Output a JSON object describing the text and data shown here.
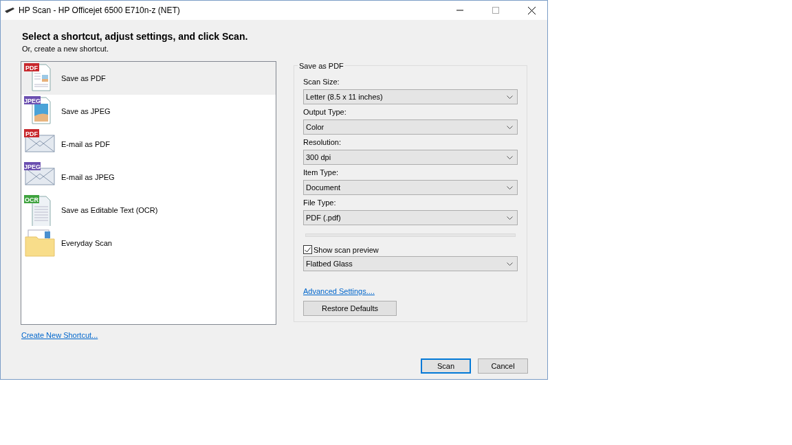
{
  "window": {
    "title": "HP Scan - HP Officejet 6500 E710n-z (NET)"
  },
  "heading": "Select a shortcut, adjust settings, and click Scan.",
  "subheading": "Or, create a new shortcut.",
  "shortcuts": [
    {
      "label": "Save as PDF",
      "kind": "document",
      "badge": "PDF",
      "color": "#c8282d",
      "selected": true
    },
    {
      "label": "Save as JPEG",
      "kind": "photo",
      "badge": "JPEG",
      "color": "#6b4fb0",
      "selected": false
    },
    {
      "label": "E-mail as PDF",
      "kind": "envelope",
      "badge": "PDF",
      "color": "#c8282d",
      "selected": false
    },
    {
      "label": "E-mail as JPEG",
      "kind": "envelope",
      "badge": "JPEG",
      "color": "#6b4fb0",
      "selected": false
    },
    {
      "label": "Save as Editable Text (OCR)",
      "kind": "text",
      "badge": "OCR",
      "color": "#3fa33f",
      "selected": false
    },
    {
      "label": "Everyday Scan",
      "kind": "folder",
      "selected": false
    }
  ],
  "create_link": "Create New Shortcut...",
  "settings": {
    "title": "Save as PDF",
    "fields": [
      {
        "label": "Scan Size:",
        "value": "Letter (8.5 x 11 inches)"
      },
      {
        "label": "Output Type:",
        "value": "Color"
      },
      {
        "label": "Resolution:",
        "value": "300 dpi"
      },
      {
        "label": "Item Type:",
        "value": "Document"
      },
      {
        "label": "File Type:",
        "value": "PDF (.pdf)"
      }
    ],
    "preview": {
      "label": "Show scan preview",
      "checked": true
    },
    "source": "Flatbed Glass",
    "advanced_link": "Advanced Settings....",
    "restore_button": "Restore Defaults"
  },
  "buttons": [
    {
      "label": "Scan",
      "default": true
    },
    {
      "label": "Cancel",
      "default": false
    }
  ]
}
